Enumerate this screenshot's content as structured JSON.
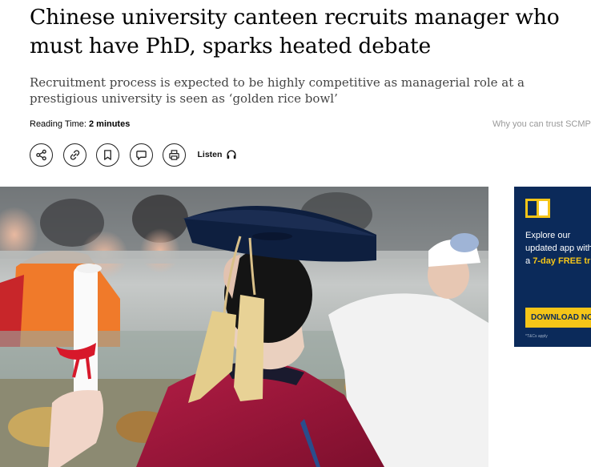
{
  "article": {
    "headline": "Chinese university canteen recruits manager who must have PhD, sparks heated debate",
    "subheadline": "Recruitment process is expected to be highly competitive as managerial role at a prestigious university is seen as ‘golden rice bowl’",
    "reading_time_label": "Reading Time: ",
    "reading_time_value": "2 minutes",
    "trust_link": "Why you can trust SCMP"
  },
  "toolbar": {
    "buttons": [
      {
        "name": "share",
        "icon": "share-icon"
      },
      {
        "name": "copy-link",
        "icon": "link-icon"
      },
      {
        "name": "bookmark",
        "icon": "bookmark-icon"
      },
      {
        "name": "comment",
        "icon": "comment-icon"
      },
      {
        "name": "print",
        "icon": "print-icon"
      }
    ],
    "listen_label": "Listen",
    "listen_icon": "headphones-icon"
  },
  "hero_image": {
    "subject": "graduate in doctoral cap and gown holding a diploma in a university canteen"
  },
  "ad": {
    "line1": "Explore our",
    "line2": "updated app with",
    "line3_prefix": "a ",
    "line3_highlight": "7-day FREE tr",
    "button_label": "DOWNLOAD NOW",
    "terms": "*T&Cs apply",
    "bg_color": "#0b2a5a",
    "accent_color": "#f5c518"
  }
}
